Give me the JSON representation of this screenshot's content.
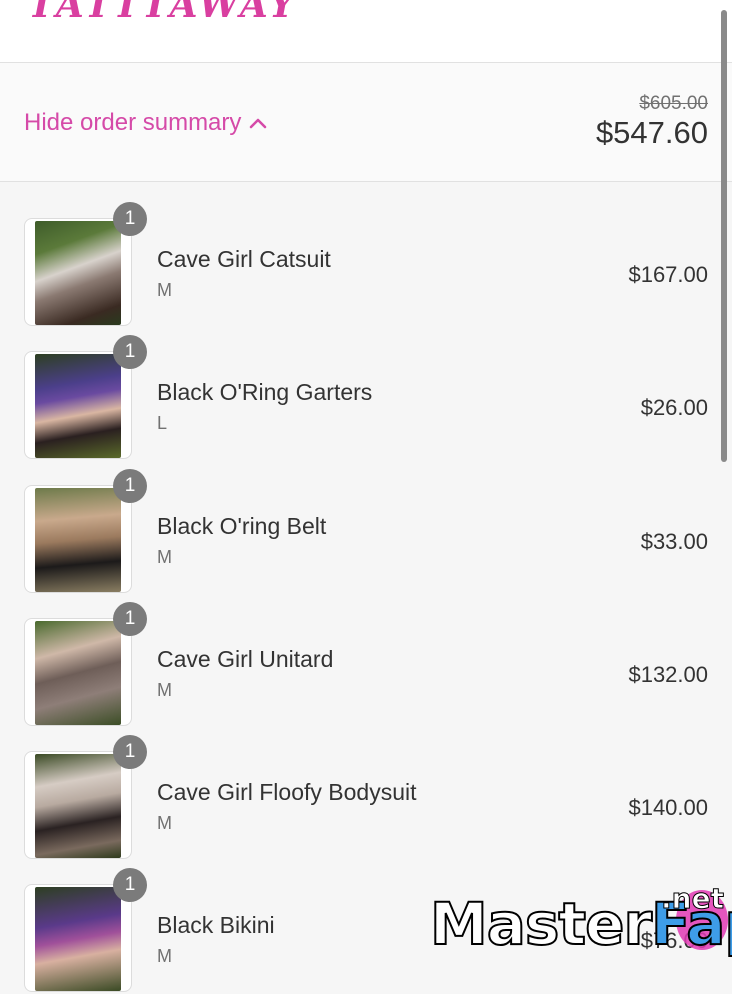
{
  "header": {
    "logo_text": "TATTTAWAY"
  },
  "summary": {
    "toggle_label": "Hide order summary",
    "original_total": "$605.00",
    "total": "$547.60"
  },
  "items": [
    {
      "name": "Cave Girl Catsuit",
      "variant": "M",
      "price": "$167.00",
      "quantity": "1"
    },
    {
      "name": "Black O'Ring Garters",
      "variant": "L",
      "price": "$26.00",
      "quantity": "1"
    },
    {
      "name": "Black O'ring Belt",
      "variant": "M",
      "price": "$33.00",
      "quantity": "1"
    },
    {
      "name": "Cave Girl Unitard",
      "variant": "M",
      "price": "$132.00",
      "quantity": "1"
    },
    {
      "name": "Cave Girl Floofy Bodysuit",
      "variant": "M",
      "price": "$140.00",
      "quantity": "1"
    },
    {
      "name": "Black Bikini",
      "variant": "M",
      "price": "$76.00",
      "quantity": "1"
    }
  ],
  "watermark": {
    "text_main": "Master",
    "text_accent": "Fap",
    "suffix": ".net"
  },
  "colors": {
    "accent": "#d54aa8",
    "badge": "#7b7b7b",
    "text": "#333333",
    "muted": "#717171"
  },
  "icons": {
    "toggle": "chevron-up-icon"
  }
}
